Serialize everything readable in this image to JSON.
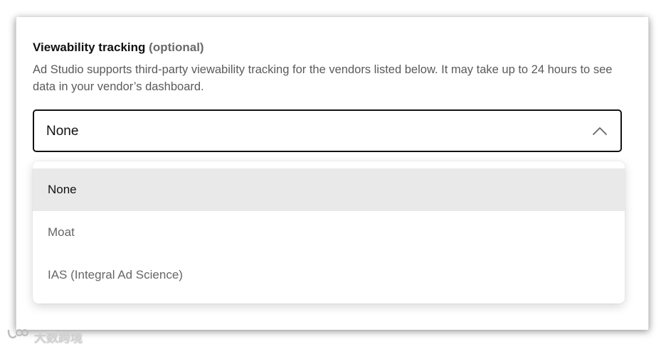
{
  "section": {
    "title": "Viewability tracking",
    "optional": "(optional)",
    "description": "Ad Studio supports third-party viewability tracking for the vendors listed below. It may take up to 24 hours to see data in your vendor’s dashboard."
  },
  "select": {
    "value": "None",
    "expanded": true,
    "chevron_icon": "chevron-up-icon"
  },
  "menu": {
    "options": [
      {
        "label": "None",
        "selected": true
      },
      {
        "label": "Moat",
        "selected": false
      },
      {
        "label": "IAS (Integral Ad Science)",
        "selected": false
      }
    ]
  },
  "watermark": {
    "text": "大数跨境",
    "icon": "brand-logo-icon"
  },
  "colors": {
    "border_active": "#121212",
    "selected_bg": "#e9e9e9",
    "muted_text": "#666666"
  }
}
